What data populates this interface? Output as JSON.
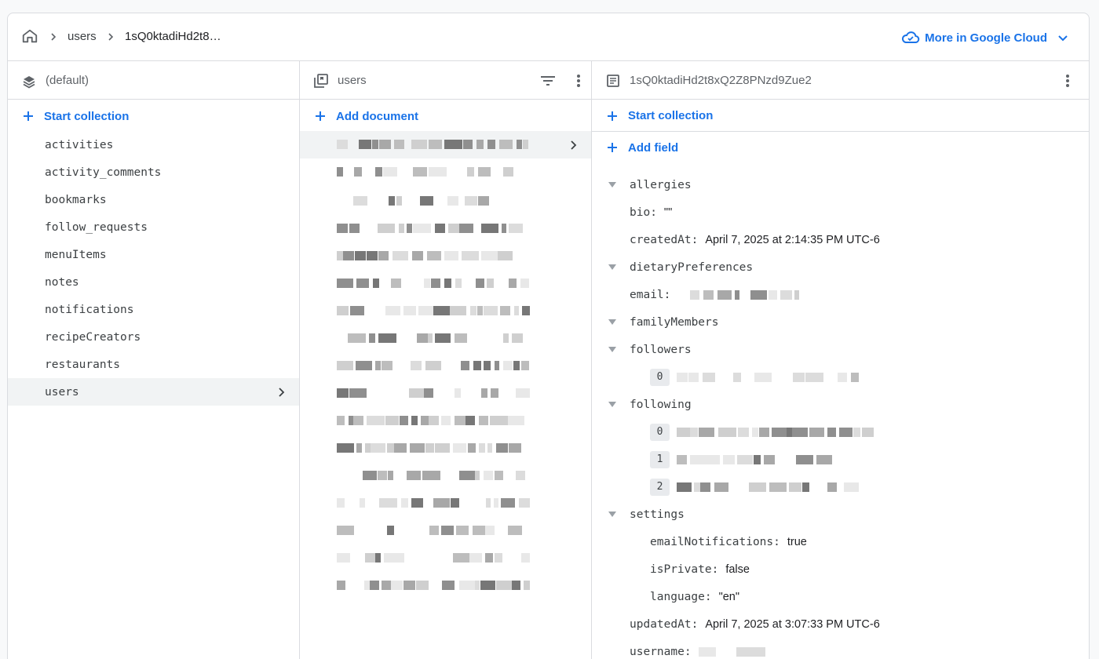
{
  "breadcrumb": {
    "items": [
      "users",
      "1sQ0ktadiHd2t8…"
    ],
    "cloud_link": "More in Google Cloud"
  },
  "col1": {
    "title": "(default)",
    "add_label": "Start collection",
    "collections": [
      "activities",
      "activity_comments",
      "bookmarks",
      "follow_requests",
      "menuItems",
      "notes",
      "notifications",
      "recipeCreators",
      "restaurants",
      "users"
    ],
    "selected": "users"
  },
  "col2": {
    "title": "users",
    "add_label": "Add document"
  },
  "col3": {
    "title": "1sQ0ktadiHd2t8xQ2Z8PNzd9Zue2",
    "start_collection_label": "Start collection",
    "add_field_label": "Add field",
    "fields": {
      "allergies": "allergies",
      "bio_key": "bio:",
      "bio_val": "\"\"",
      "createdAt_key": "createdAt:",
      "createdAt_val": "April 7, 2025 at 2:14:35 PM UTC-6",
      "dietaryPreferences": "dietaryPreferences",
      "email_key": "email:",
      "familyMembers": "familyMembers",
      "followers": "followers",
      "following": "following",
      "idx0": "0",
      "idx1": "1",
      "idx2": "2",
      "settings": "settings",
      "emailNotifications_key": "emailNotifications:",
      "emailNotifications_val": "true",
      "isPrivate_key": "isPrivate:",
      "isPrivate_val": "false",
      "language_key": "language:",
      "language_val": "\"en\"",
      "updatedAt_key": "updatedAt:",
      "updatedAt_val": "April 7, 2025 at 3:07:33 PM UTC-6",
      "username_key": "username:"
    }
  },
  "colors": {
    "accent": "#1a73e8",
    "border": "#dadce0",
    "selected_bg": "#f1f3f4"
  }
}
